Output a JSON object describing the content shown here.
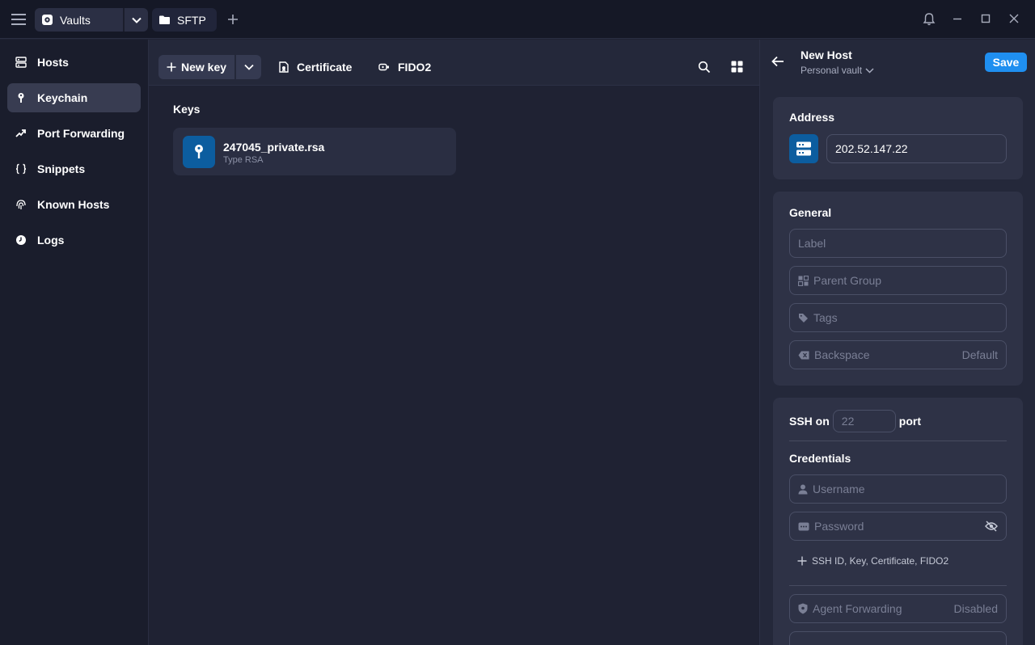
{
  "titlebar": {
    "vault_tab_label": "Vaults",
    "sftp_tab_label": "SFTP"
  },
  "sidebar": {
    "items": [
      {
        "label": "Hosts",
        "icon": "hosts-icon"
      },
      {
        "label": "Keychain",
        "icon": "key-icon",
        "active": true
      },
      {
        "label": "Port Forwarding",
        "icon": "port-forwarding-icon"
      },
      {
        "label": "Snippets",
        "icon": "braces-icon"
      },
      {
        "label": "Known Hosts",
        "icon": "fingerprint-icon"
      },
      {
        "label": "Logs",
        "icon": "clock-icon"
      }
    ]
  },
  "toolbar": {
    "new_key_label": "New key",
    "certificate_label": "Certificate",
    "fido2_label": "FIDO2"
  },
  "main": {
    "section_title": "Keys",
    "keys": [
      {
        "name": "247045_private.rsa",
        "type": "Type RSA"
      }
    ]
  },
  "panel": {
    "title": "New Host",
    "vault": "Personal vault",
    "save_label": "Save",
    "address": {
      "title": "Address",
      "value": "202.52.147.22"
    },
    "general": {
      "title": "General",
      "label_placeholder": "Label",
      "parent_group_placeholder": "Parent Group",
      "tags_placeholder": "Tags",
      "backspace_label": "Backspace",
      "backspace_value": "Default"
    },
    "ssh": {
      "ssh_on": "SSH on",
      "port_placeholder": "22",
      "port_label": "port",
      "credentials_title": "Credentials",
      "username_placeholder": "Username",
      "password_placeholder": "Password",
      "add_credential": "SSH ID, Key, Certificate, FIDO2",
      "agent_forwarding_label": "Agent Forwarding",
      "agent_forwarding_value": "Disabled"
    }
  },
  "colors": {
    "accent": "#1f8ff0",
    "icon_bg": "#0c5d9f",
    "background": "#1f2233"
  }
}
